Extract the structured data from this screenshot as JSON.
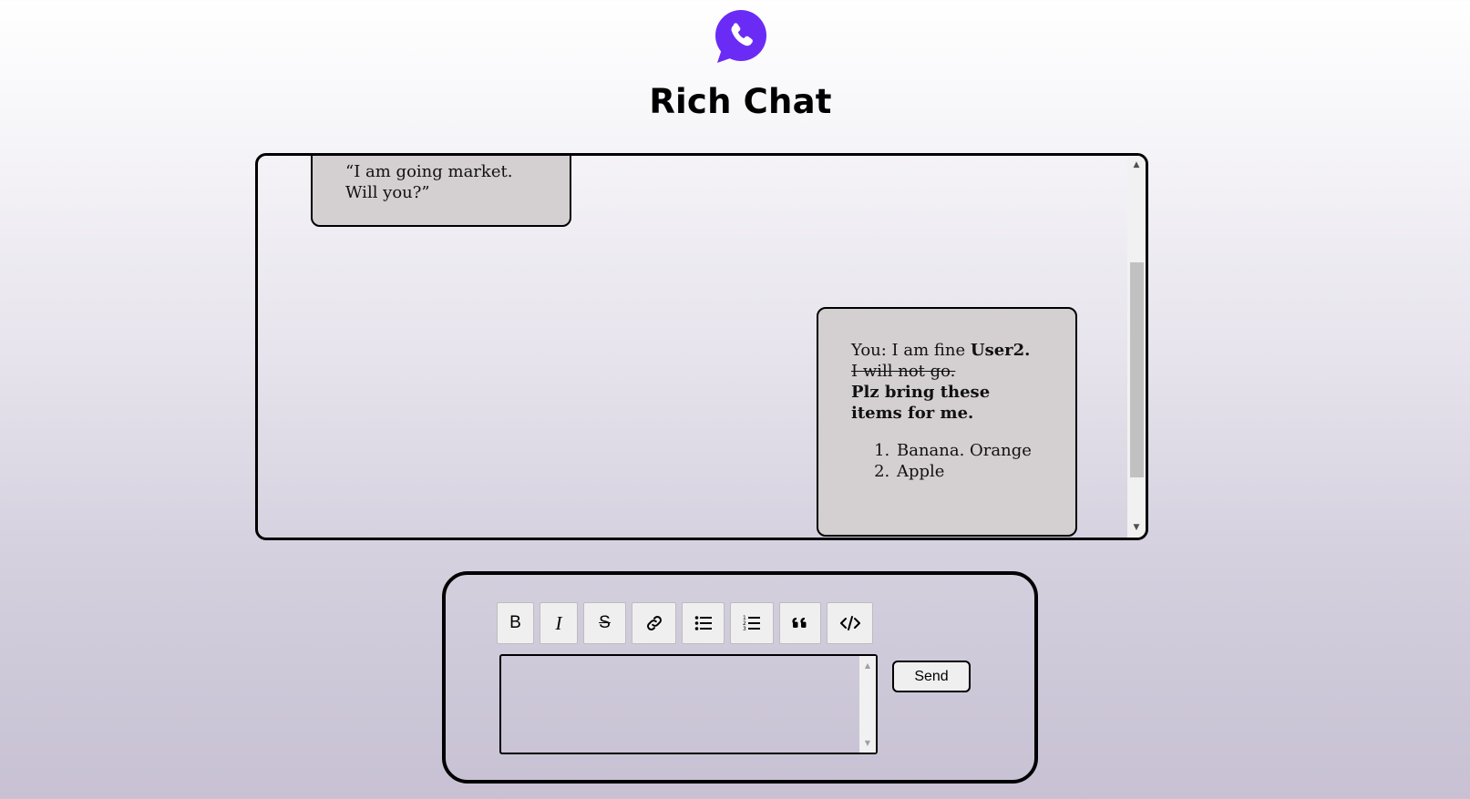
{
  "app": {
    "title": "Rich Chat",
    "logo_icon": "phone-chat-bubble-icon",
    "logo_color": "#6a2cf5"
  },
  "chat": {
    "messages": [
      {
        "side": "left",
        "text": "“I am going market. Will you?”"
      },
      {
        "side": "right",
        "prefix": "You: I am fine ",
        "bold_name": "User2.",
        "strikethrough": "I will not go.",
        "bold_line": "Plz bring these items for me.",
        "list": [
          "Banana. Orange",
          "Apple"
        ]
      }
    ],
    "bubble_color": "#d4cfd0"
  },
  "composer": {
    "toolbar": [
      {
        "name": "bold",
        "label": "B",
        "icon": "bold-icon"
      },
      {
        "name": "italic",
        "label": "I",
        "icon": "italic-icon"
      },
      {
        "name": "strikethrough",
        "label": "S",
        "icon": "strikethrough-icon"
      },
      {
        "name": "link",
        "icon": "link-icon"
      },
      {
        "name": "bullet-list",
        "icon": "bullet-list-icon"
      },
      {
        "name": "ordered-list",
        "icon": "ordered-list-icon"
      },
      {
        "name": "quote",
        "icon": "quote-icon"
      },
      {
        "name": "code",
        "icon": "code-icon"
      }
    ],
    "input_value": "",
    "send_label": "Send"
  }
}
